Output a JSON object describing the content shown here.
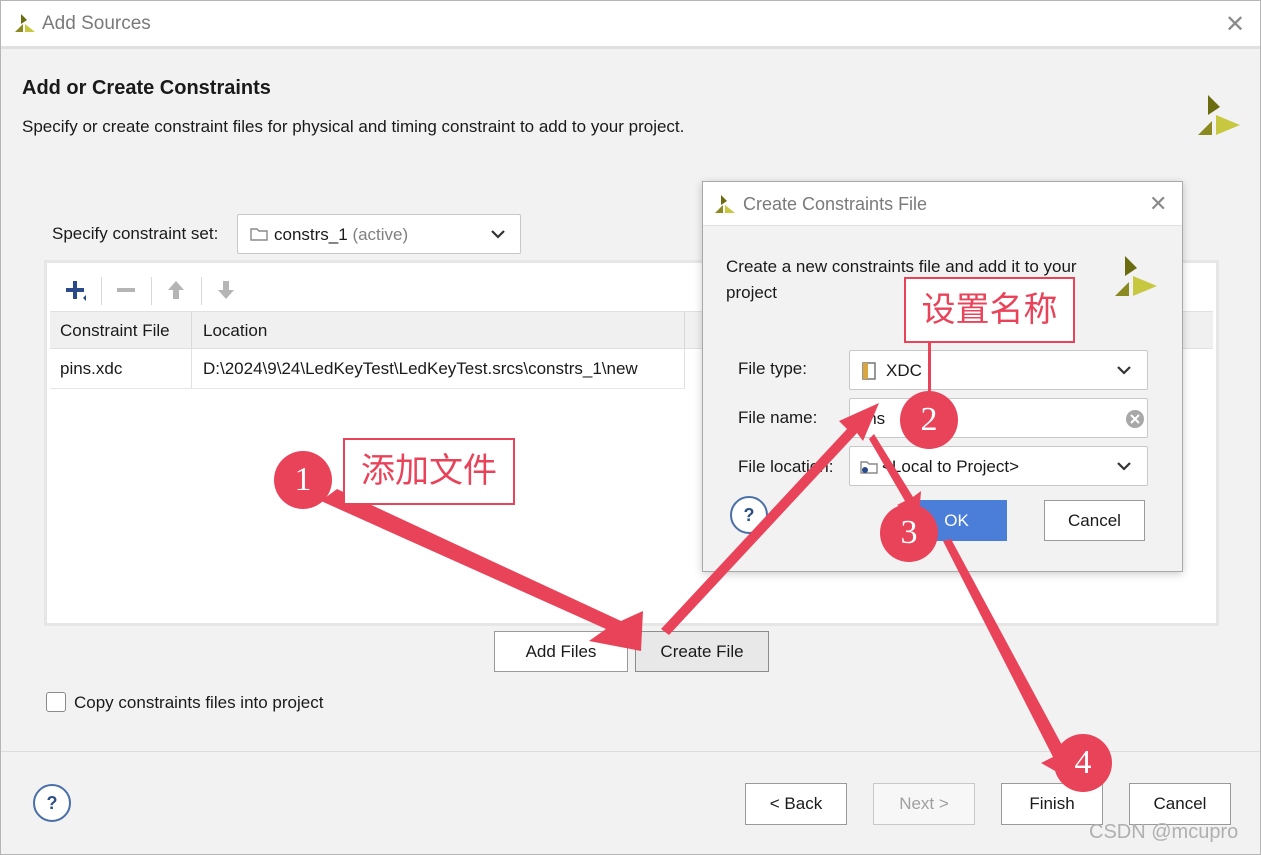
{
  "window": {
    "title": "Add Sources"
  },
  "header": {
    "title": "Add or Create Constraints",
    "subtitle": "Specify or create constraint files for physical and timing constraint to add to your project."
  },
  "constraint_set": {
    "label": "Specify constraint set:",
    "value": "constrs_1",
    "status": "(active)"
  },
  "table": {
    "columns": [
      "Constraint File",
      "Location"
    ],
    "rows": [
      {
        "file": "pins.xdc",
        "location": "D:\\2024\\9\\24\\LedKeyTest\\LedKeyTest.srcs\\constrs_1\\new"
      }
    ]
  },
  "buttons": {
    "add_files": "Add Files",
    "create_file": "Create File",
    "back": "< Back",
    "next": "Next >",
    "finish": "Finish",
    "cancel": "Cancel",
    "help": "?"
  },
  "copy_checkbox": {
    "label": "Copy constraints files into project",
    "checked": false
  },
  "dialog": {
    "title": "Create Constraints File",
    "description": "Create a new constraints file and add it to your project",
    "file_type_label": "File type:",
    "file_type_value": "XDC",
    "file_name_label": "File name:",
    "file_name_value": "pins",
    "file_location_label": "File location:",
    "file_location_value": "<Local to Project>",
    "ok": "OK",
    "cancel": "Cancel",
    "help": "?"
  },
  "annotations": {
    "step1": "1",
    "step2": "2",
    "step3": "3",
    "step4": "4",
    "label_add_file": "添加文件",
    "label_set_name": "设置名称"
  },
  "watermark": "CSDN @mcupro",
  "colors": {
    "annotation": "#e9435a",
    "primary_button": "#4a7ed9",
    "logo_dark": "#7a7a1a",
    "logo_light": "#c8c840"
  }
}
